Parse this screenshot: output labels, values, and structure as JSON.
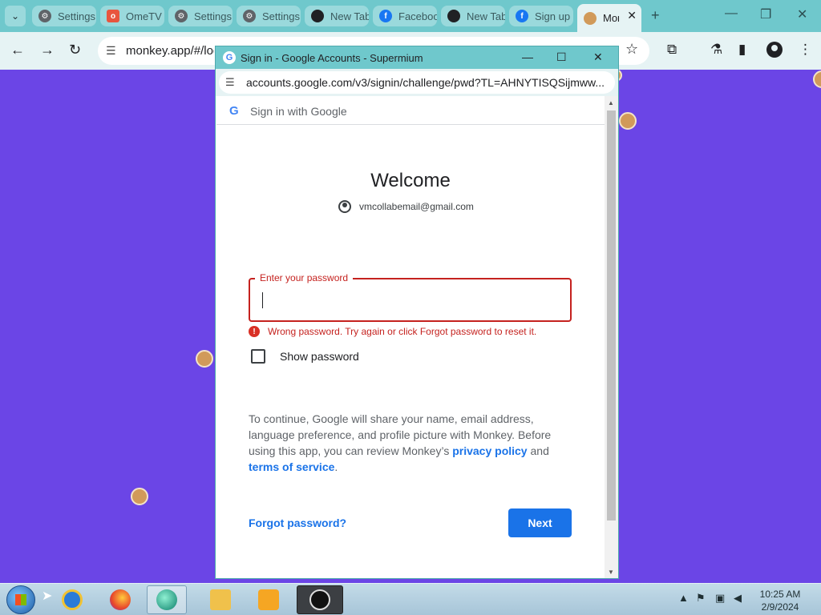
{
  "browser": {
    "tabs": [
      {
        "label": "Settings",
        "favicon": "gear-icon"
      },
      {
        "label": "OmeTV",
        "favicon": "ometv-icon"
      },
      {
        "label": "Settings",
        "favicon": "gear-icon"
      },
      {
        "label": "Settings",
        "favicon": "gear-icon"
      },
      {
        "label": "New Tab",
        "favicon": "chat-icon"
      },
      {
        "label": "Facebook",
        "favicon": "facebook-icon"
      },
      {
        "label": "New Tab",
        "favicon": "chat-icon"
      },
      {
        "label": "Sign up",
        "favicon": "facebook-icon"
      },
      {
        "label": "Monkey",
        "favicon": "monkey-icon",
        "active": true
      }
    ],
    "address": "monkey.app/#/login",
    "accent": "#6fc8cc"
  },
  "popup": {
    "window_title": "Sign in - Google Accounts - Supermium",
    "url": "accounts.google.com/v3/signin/challenge/pwd?TL=AHNYTISQSijmww...",
    "header_text": "Sign in with Google",
    "welcome": "Welcome",
    "email": "vmcollabemail@gmail.com",
    "password_label": "Enter your password",
    "password_value": "",
    "error_text": "Wrong password. Try again or click Forgot password to reset it.",
    "show_password": "Show password",
    "info_prefix": "To continue, Google will share your name, email address, language preference, and profile picture with Monkey. Before using this app, you can review Monkey’s ",
    "privacy_link": "privacy policy",
    "info_and": " and ",
    "terms_link": "terms of service",
    "info_suffix": ".",
    "forgot_label": "Forgot password?",
    "next_label": "Next",
    "colors": {
      "error": "#c5221f",
      "link": "#1a73e8",
      "button": "#1a73e8"
    }
  },
  "taskbar": {
    "apps": [
      "internet-explorer-icon",
      "firefox-icon",
      "supermium-icon",
      "file-explorer-icon",
      "media-player-icon",
      "obs-icon"
    ],
    "time": "10:25 AM",
    "date": "2/9/2024"
  },
  "page_background": "#6b45e6"
}
